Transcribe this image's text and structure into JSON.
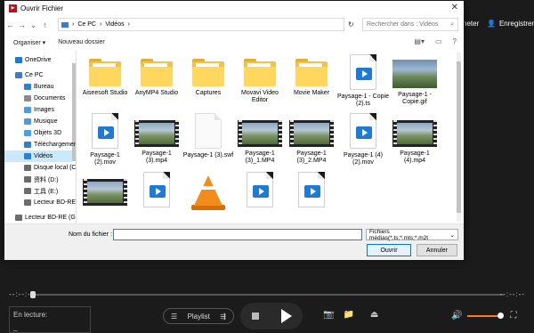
{
  "app": {
    "top_buttons": {
      "acheter": "heter",
      "enregistrer": "Enregistrer"
    },
    "seek": {
      "time_left": "--:--:--",
      "time_right": "--:--:--"
    },
    "now_playing": {
      "label": "En lecture:",
      "value": "_"
    },
    "playlist_label": "Playlist",
    "volume_color": "#ff7a1a"
  },
  "dialog": {
    "title": "Ouvrir Fichier",
    "breadcrumb": [
      "Ce PC",
      "Vidéos"
    ],
    "search_placeholder": "Rechercher dans : Vidéos",
    "commands": {
      "organize": "Organiser ▾",
      "new_folder": "Nouveau dossier"
    },
    "nav": [
      {
        "label": "OneDrive",
        "icon": "cloud-icon",
        "color": "#1e78d6"
      },
      {
        "label": "Ce PC",
        "icon": "pc-icon",
        "color": "#3a7bd5"
      },
      {
        "label": "Bureau",
        "icon": "desktop-icon",
        "color": "#2e7fd8"
      },
      {
        "label": "Documents",
        "icon": "documents-icon",
        "color": "#8a8a8a"
      },
      {
        "label": "Images",
        "icon": "images-icon",
        "color": "#4d9be0"
      },
      {
        "label": "Musique",
        "icon": "music-icon",
        "color": "#4d9be0"
      },
      {
        "label": "Objets 3D",
        "icon": "objects-3d-icon",
        "color": "#4aa0e8"
      },
      {
        "label": "Téléchargements",
        "icon": "download-icon",
        "color": "#2e7fd8"
      },
      {
        "label": "Vidéos",
        "icon": "videos-icon",
        "color": "#2e7fd8",
        "selected": true
      },
      {
        "label": "Disque local (C:)",
        "icon": "disk-icon",
        "color": "#6b6b6b"
      },
      {
        "label": "资料 (D:)",
        "icon": "disk-icon",
        "color": "#6b6b6b"
      },
      {
        "label": "工具 (E:)",
        "icon": "disk-icon",
        "color": "#6b6b6b"
      },
      {
        "label": "Lecteur BD-RE (G",
        "icon": "disc-drive-icon",
        "color": "#6b6b6b"
      },
      {
        "label": "Lecteur BD-RE (G:",
        "icon": "disc-drive-icon",
        "color": "#6b6b6b"
      }
    ],
    "files": [
      {
        "name": "Aiseesoft Studio",
        "kind": "folder"
      },
      {
        "name": "AnyMP4 Studio",
        "kind": "folder"
      },
      {
        "name": "Captures",
        "kind": "folder"
      },
      {
        "name": "Movavi Video Editor",
        "kind": "folder"
      },
      {
        "name": "Movie Maker",
        "kind": "folder"
      },
      {
        "name": "Paysage-1 - Copie (2).ts",
        "kind": "video-doc"
      },
      {
        "name": "Paysage-1 - Copie.gif",
        "kind": "photo"
      },
      {
        "name": "Paysage-1 (2).mov",
        "kind": "video-doc"
      },
      {
        "name": "Paysage-1 (3).mp4",
        "kind": "filmstrip"
      },
      {
        "name": "Paysage-1 (3).swf",
        "kind": "blank"
      },
      {
        "name": "Paysage-1 (3)_1.MP4",
        "kind": "filmstrip"
      },
      {
        "name": "Paysage-1 (3)_2.MP4",
        "kind": "filmstrip"
      },
      {
        "name": "Paysage-1 (4) (2).mov",
        "kind": "video-doc"
      },
      {
        "name": "Paysage-1 (4).mp4",
        "kind": "filmstrip"
      },
      {
        "name": "",
        "kind": "filmstrip"
      },
      {
        "name": "",
        "kind": "video-doc"
      },
      {
        "name": "",
        "kind": "vlc"
      },
      {
        "name": "",
        "kind": "video-doc"
      },
      {
        "name": "",
        "kind": "video-doc"
      }
    ],
    "filename_label": "Nom du fichier :",
    "filename_value": "",
    "filetype": "Fichiers médias(*.ts;*.mts;*.m2t",
    "open_label": "Ouvrir",
    "cancel_label": "Annuler"
  }
}
